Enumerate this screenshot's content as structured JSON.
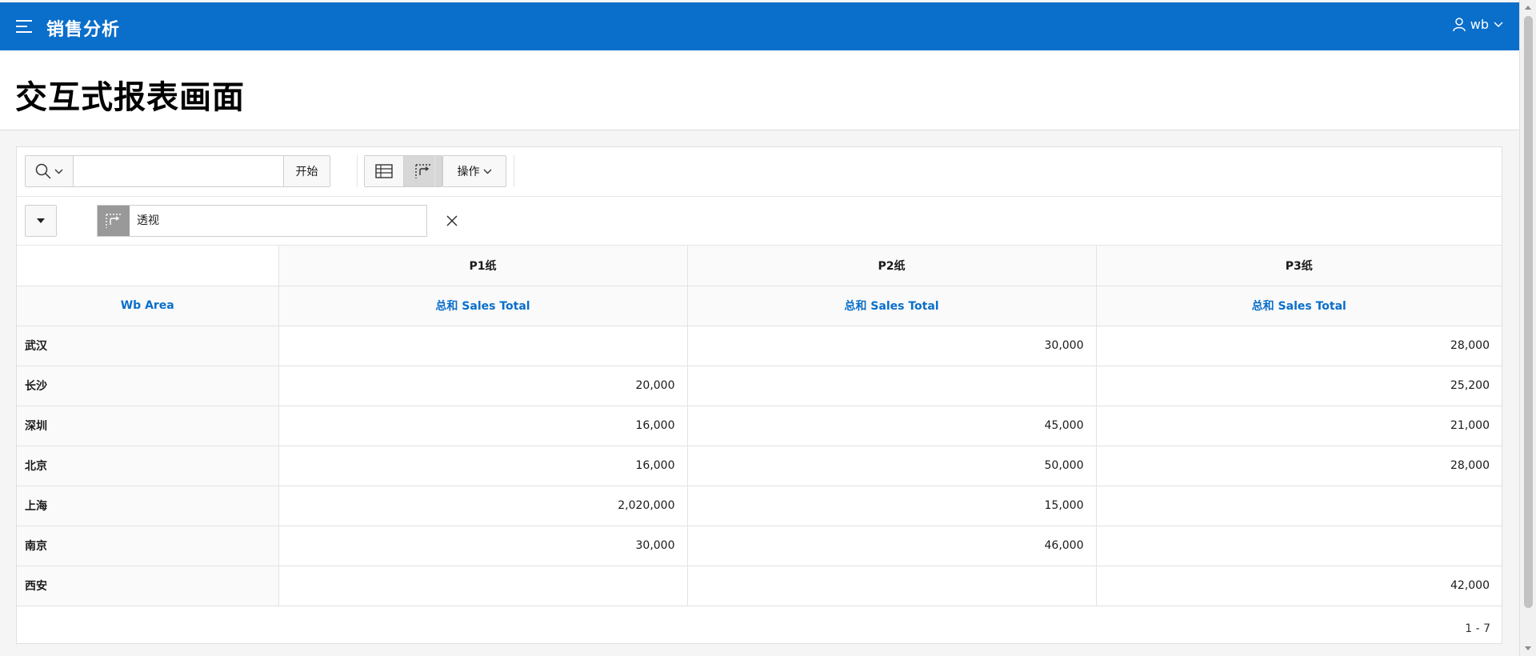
{
  "header": {
    "app_title": "销售分析",
    "user_name": "wb",
    "bar_color": "#0a6ecb"
  },
  "page": {
    "title": "交互式报表画面"
  },
  "toolbar": {
    "search_icon": "search-icon",
    "search_placeholder": "",
    "go_label": "开始",
    "view_report_icon": "table-icon",
    "view_pivot_icon": "pivot-icon",
    "actions_label": "操作"
  },
  "filters": {
    "pivot_label": "透视",
    "remove_icon": "close-icon"
  },
  "grid": {
    "pivot_columns": [
      "P1纸",
      "P2纸",
      "P3纸"
    ],
    "row_header_label": "Wb Area",
    "measure_label": "总和 Sales Total",
    "rows": [
      {
        "area": "武汉",
        "values": [
          "",
          "30,000",
          "28,000"
        ]
      },
      {
        "area": "长沙",
        "values": [
          "20,000",
          "",
          "25,200"
        ]
      },
      {
        "area": "深圳",
        "values": [
          "16,000",
          "45,000",
          "21,000"
        ]
      },
      {
        "area": "北京",
        "values": [
          "16,000",
          "50,000",
          "28,000"
        ]
      },
      {
        "area": "上海",
        "values": [
          "2,020,000",
          "15,000",
          ""
        ]
      },
      {
        "area": "南京",
        "values": [
          "30,000",
          "46,000",
          ""
        ]
      },
      {
        "area": "西安",
        "values": [
          "",
          "",
          "42,000"
        ]
      }
    ]
  },
  "pagination": {
    "range": "1 - 7"
  }
}
